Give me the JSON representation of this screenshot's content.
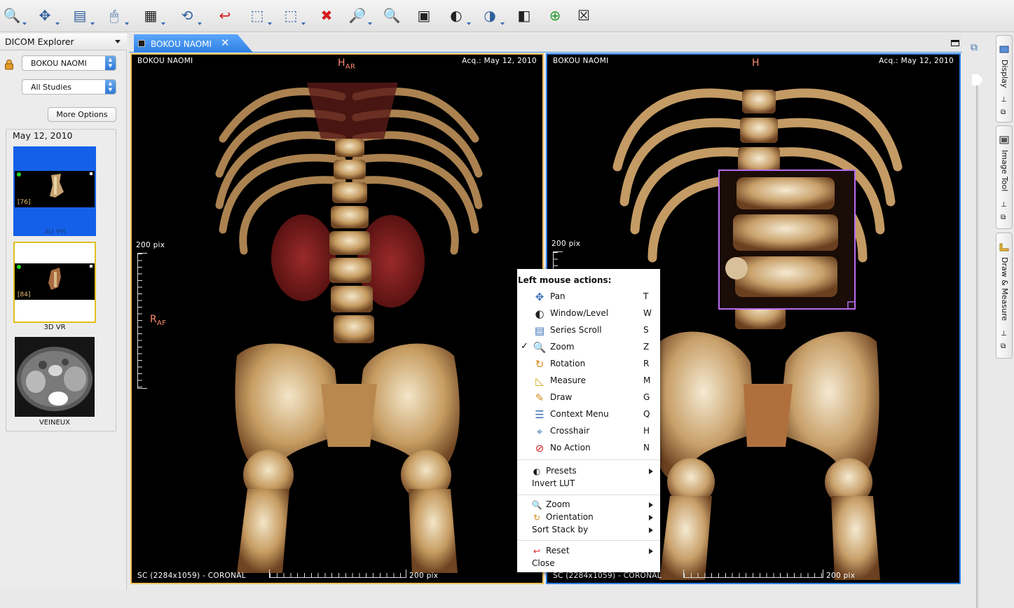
{
  "toolbar": {
    "buttons": [
      {
        "name": "open-icon",
        "glyph": "🔍"
      },
      {
        "name": "import-icon",
        "glyph": "✥"
      },
      {
        "name": "export-icon",
        "glyph": "▤"
      },
      {
        "name": "mouse-actions-icon",
        "glyph": "🖱"
      },
      {
        "name": "layout-grid-icon",
        "glyph": "▦"
      },
      {
        "name": "synch-icon",
        "glyph": "⟲"
      },
      {
        "name": "reset-icon",
        "glyph": "↩"
      },
      {
        "name": "select-roi-icon",
        "glyph": "⬚"
      },
      {
        "name": "zoom-roi-icon",
        "glyph": "⬚"
      },
      {
        "name": "delete-icon",
        "glyph": "✖"
      },
      {
        "name": "magnifier-icon",
        "glyph": "🔎"
      },
      {
        "name": "zoom-actual-icon",
        "glyph": "🔍"
      },
      {
        "name": "screenshot-icon",
        "glyph": "▣"
      },
      {
        "name": "window-level-icon",
        "glyph": "◐"
      },
      {
        "name": "lut-icon",
        "glyph": "◑"
      },
      {
        "name": "invert-lut-icon",
        "glyph": "◧"
      },
      {
        "name": "3d-mpr-icon",
        "glyph": "⊕"
      },
      {
        "name": "volume-rendering-icon",
        "glyph": "☒"
      }
    ]
  },
  "left_panel": {
    "title": "DICOM Explorer",
    "patient_combo": "BOKOU NAOMI",
    "studies_combo": "All Studies",
    "more_options": "More Options",
    "study_date": "May 12, 2010",
    "thumbnails": [
      {
        "index_label": "[76]",
        "label": "3D VR"
      },
      {
        "index_label": "[84]",
        "label": "3D VR"
      },
      {
        "index_label": "",
        "label": "VEINEUX"
      }
    ]
  },
  "view_tab": {
    "label": "BOKOU NAOMI",
    "close": "✕"
  },
  "viewport_left": {
    "patient": "BOKOU NAOMI",
    "acq": "Acq.: May 12, 2010",
    "top_orient": "H",
    "top_orient_sub": "AR",
    "left_orient": "R",
    "left_orient_sub": "AF",
    "scale_v": "200 pix",
    "scale_h": "200 pix",
    "series": "SC (2284x1059) - CORONAL"
  },
  "viewport_right": {
    "patient": "BOKOU NAOMI",
    "acq": "Acq.: May 12, 2010",
    "top_orient": "H",
    "scale_v": "200 pix",
    "scale_h": "200 pix",
    "series": "SC (2284x1059) - CORONAL"
  },
  "context_menu": {
    "header": "Left mouse actions:",
    "actions": [
      {
        "label": "Pan",
        "key": "T",
        "icon": "pan-icon",
        "glyph": "✥",
        "color": "#3a6fb5",
        "checked": false
      },
      {
        "label": "Window/Level",
        "key": "W",
        "icon": "window-level-icon",
        "glyph": "◐",
        "color": "#222222",
        "checked": false
      },
      {
        "label": "Series Scroll",
        "key": "S",
        "icon": "series-scroll-icon",
        "glyph": "▤",
        "color": "#3a6fb5",
        "checked": false
      },
      {
        "label": "Zoom",
        "key": "Z",
        "icon": "zoom-icon",
        "glyph": "🔍",
        "color": "#3a6fb5",
        "checked": true
      },
      {
        "label": "Rotation",
        "key": "R",
        "icon": "rotation-icon",
        "glyph": "↻",
        "color": "#d08a1c",
        "checked": false
      },
      {
        "label": "Measure",
        "key": "M",
        "icon": "measure-icon",
        "glyph": "◺",
        "color": "#d9a520",
        "checked": false
      },
      {
        "label": "Draw",
        "key": "G",
        "icon": "draw-icon",
        "glyph": "✎",
        "color": "#d08a1c",
        "checked": false
      },
      {
        "label": "Context Menu",
        "key": "Q",
        "icon": "context-menu-icon",
        "glyph": "☰",
        "color": "#3a6fb5",
        "checked": false
      },
      {
        "label": "Crosshair",
        "key": "H",
        "icon": "crosshair-icon",
        "glyph": "⌖",
        "color": "#3a6fb5",
        "checked": false
      },
      {
        "label": "No Action",
        "key": "N",
        "icon": "no-action-icon",
        "glyph": "⊘",
        "color": "#cc2222",
        "checked": false
      }
    ],
    "presets": "Presets",
    "invert_lut": "Invert LUT",
    "zoom": "Zoom",
    "orientation": "Orientation",
    "sort_stack": "Sort Stack by",
    "reset": "Reset",
    "close": "Close"
  },
  "right_tabs": {
    "display": "Display",
    "image_tool": "Image Tool",
    "draw_measure": "Draw & Measure"
  },
  "colors": {
    "accent": "#2f7fe1",
    "orientation_label": "#ff8a70",
    "roi_box": "#b86cf0",
    "active_viewport_border": "#f0c05a"
  }
}
